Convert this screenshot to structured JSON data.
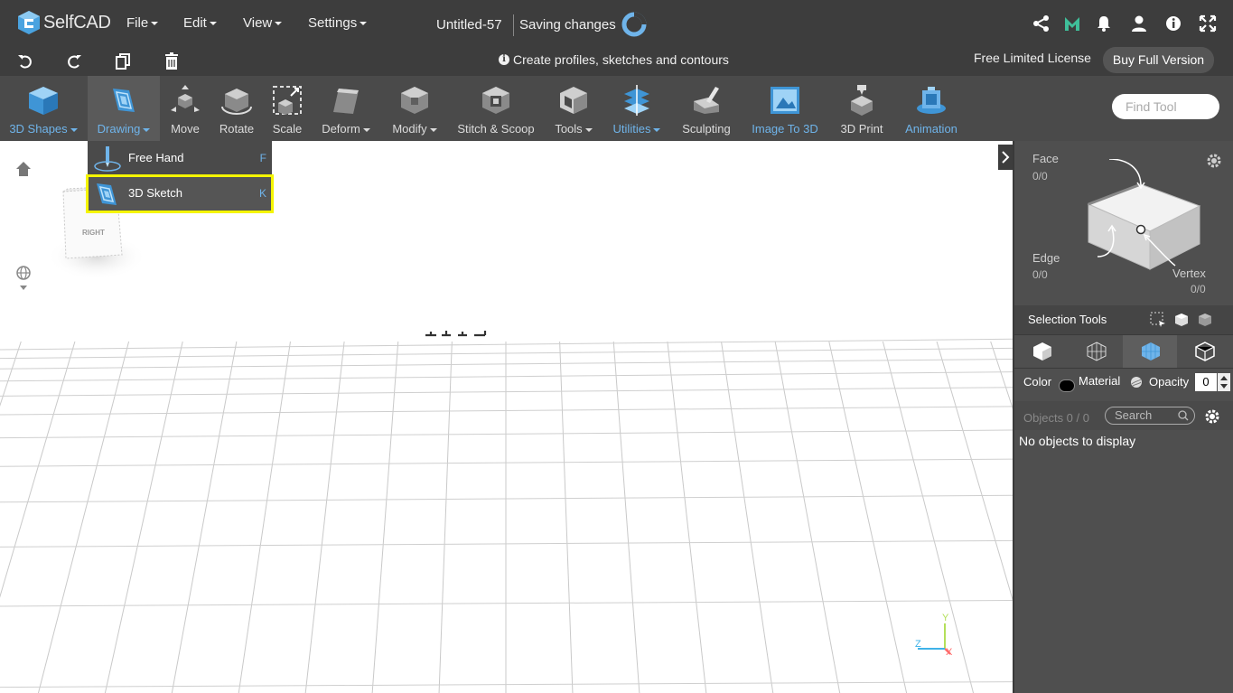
{
  "app": {
    "name": "SelfCAD"
  },
  "menus": [
    {
      "label": "File"
    },
    {
      "label": "Edit"
    },
    {
      "label": "View"
    },
    {
      "label": "Settings"
    }
  ],
  "document": {
    "title": "Untitled-57",
    "status": "Saving changes"
  },
  "hint": {
    "text": "Create profiles, sketches and contours"
  },
  "license": {
    "text": "Free Limited License",
    "buy_label": "Buy Full Version"
  },
  "toolbar": {
    "tools": [
      {
        "label": "3D Shapes",
        "icon": "cube-icon",
        "dropdown": true,
        "color": "blue"
      },
      {
        "label": "Drawing",
        "icon": "drawing-icon",
        "dropdown": true,
        "color": "blue",
        "active": true
      },
      {
        "label": "Move",
        "icon": "move-icon"
      },
      {
        "label": "Rotate",
        "icon": "rotate-icon"
      },
      {
        "label": "Scale",
        "icon": "scale-icon"
      },
      {
        "label": "Deform",
        "icon": "deform-icon",
        "dropdown": true
      },
      {
        "label": "Modify",
        "icon": "modify-icon",
        "dropdown": true
      },
      {
        "label": "Stitch & Scoop",
        "icon": "stitch-scoop-icon"
      },
      {
        "label": "Tools",
        "icon": "tools-icon",
        "dropdown": true
      },
      {
        "label": "Utilities",
        "icon": "utilities-icon",
        "dropdown": true,
        "color": "blue"
      },
      {
        "label": "Sculpting",
        "icon": "sculpting-icon"
      },
      {
        "label": "Image To 3D",
        "icon": "image-to-3d-icon",
        "color": "blue"
      },
      {
        "label": "3D Print",
        "icon": "3d-print-icon"
      },
      {
        "label": "Animation",
        "icon": "animation-icon",
        "color": "blue"
      }
    ],
    "find_placeholder": "Find Tool"
  },
  "drawing_menu": {
    "items": [
      {
        "label": "Free Hand",
        "shortcut": "F"
      },
      {
        "label": "3D Sketch",
        "shortcut": "K",
        "highlighted": true
      }
    ]
  },
  "viewport": {
    "view_cube_label": "RIGHT",
    "axis": {
      "x": "X",
      "y": "Y",
      "z": "Z"
    }
  },
  "selection_panel": {
    "face_label": "Face",
    "face_value": "0/0",
    "edge_label": "Edge",
    "edge_value": "0/0",
    "vertex_label": "Vertex",
    "vertex_value": "0/0",
    "tools_label": "Selection Tools"
  },
  "properties": {
    "color_label": "Color",
    "material_label": "Material",
    "opacity_label": "Opacity",
    "opacity_value": "0"
  },
  "objects": {
    "count_label": "Objects 0 / 0",
    "search_placeholder": "Search",
    "empty_text": "No objects to display"
  },
  "colors": {
    "accent_blue": "#6fb4ea",
    "highlight": "#f5f500",
    "toolbar_bg": "#4a4a4a",
    "topbar_bg": "#3d3d3d"
  }
}
